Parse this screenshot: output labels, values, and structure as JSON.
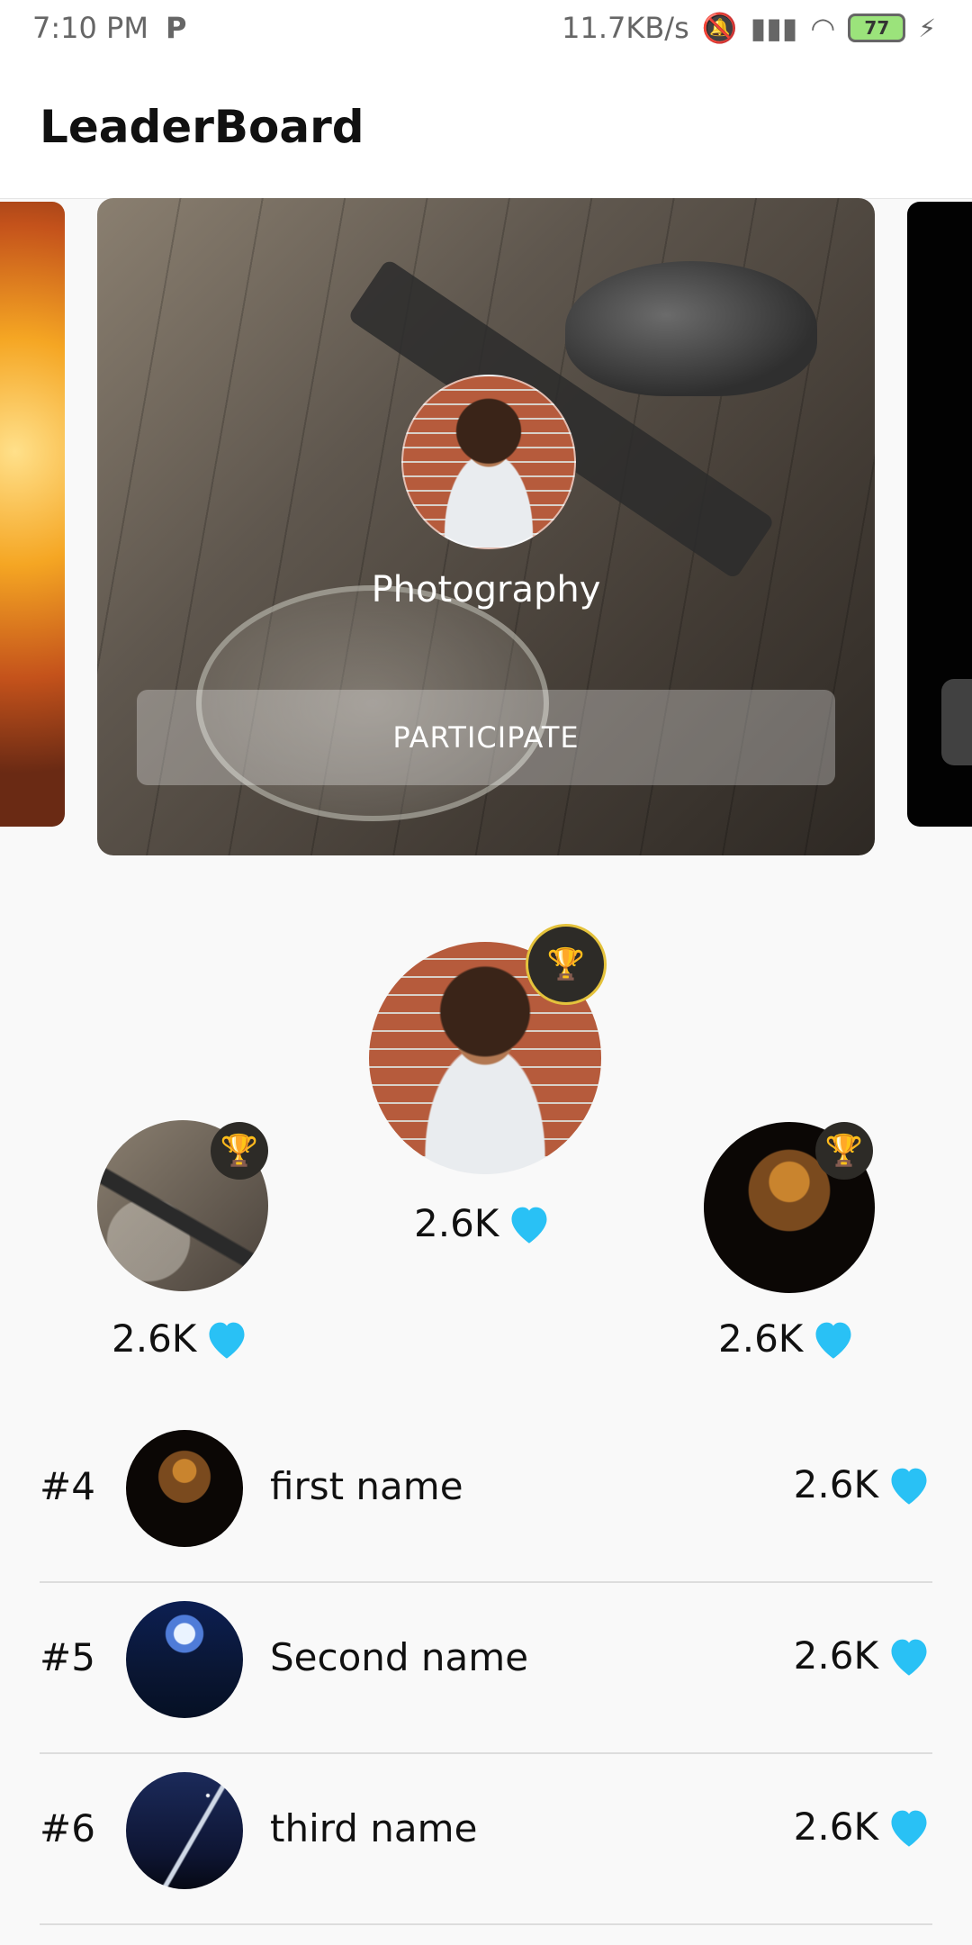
{
  "status_bar": {
    "time": "7:10 PM",
    "notification_icon": "P",
    "network_speed": "11.7KB/s",
    "battery_level": "77"
  },
  "app_bar": {
    "title": "LeaderBoard"
  },
  "carousel": {
    "active_card": {
      "title": "Photography",
      "button_label": "PARTICIPATE"
    }
  },
  "podium": {
    "first": {
      "score": "2.6K"
    },
    "second": {
      "score": "2.6K"
    },
    "third": {
      "score": "2.6K"
    }
  },
  "leaderboard": [
    {
      "rank": "#4",
      "name": "first name",
      "score": "2.6K"
    },
    {
      "rank": "#5",
      "name": "Second name",
      "score": "2.6K"
    },
    {
      "rank": "#6",
      "name": "third name",
      "score": "2.6K"
    }
  ],
  "colors": {
    "accent_heart": "#29c1f5",
    "trophy": "#f4b400"
  }
}
